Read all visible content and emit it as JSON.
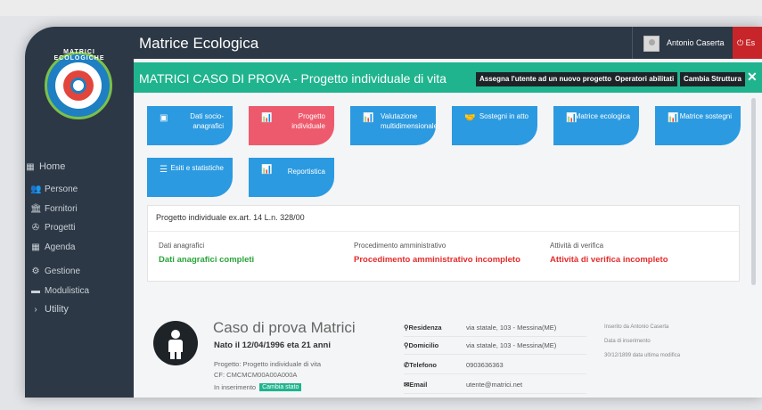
{
  "app": {
    "title": "Matrice Ecologica"
  },
  "logo": {
    "text": "MATRICI ECOLOGICHE"
  },
  "user": {
    "name": "Antonio Caserta",
    "exit_label": "Es"
  },
  "sidebar": {
    "items": [
      {
        "icon": "calendar-icon",
        "glyph": "▦",
        "label": "Home"
      },
      {
        "icon": "users-icon",
        "glyph": "👥",
        "label": "Persone"
      },
      {
        "icon": "bank-icon",
        "glyph": "🏛",
        "label": "Fornitori"
      },
      {
        "icon": "projects-icon",
        "glyph": "✇",
        "label": "Progetti"
      },
      {
        "icon": "calendar-icon",
        "glyph": "▦",
        "label": "Agenda"
      },
      {
        "icon": "gears-icon",
        "glyph": "⚙",
        "label": "Gestione"
      },
      {
        "icon": "folder-icon",
        "glyph": "▬",
        "label": "Modulistica"
      },
      {
        "icon": "chevron-right-icon",
        "glyph": "›",
        "label": "Utility"
      }
    ]
  },
  "banner": {
    "title": "MATRICI CASO DI PROVA - Progetto individuale di vita",
    "buttons": [
      "Assegna l'utente ad un nuovo progetto",
      "Operatori abilitati",
      "Cambia Struttura"
    ],
    "close": "✕"
  },
  "tiles": [
    {
      "label": "Dati socio-anagrafici",
      "icon": "id-card-icon",
      "glyph": "▣",
      "color": "#2b9ae0"
    },
    {
      "label": "Progetto individuale",
      "icon": "bar-chart-icon",
      "glyph": "📊",
      "color": "#ee5a6d"
    },
    {
      "label": "Valutazione multidimensionale",
      "icon": "bar-chart-icon",
      "glyph": "📊",
      "color": "#2b9ae0"
    },
    {
      "label": "Sostegni in atto",
      "icon": "handshake-icon",
      "glyph": "🤝",
      "color": "#2b9ae0"
    },
    {
      "label": "Matrice ecologica",
      "icon": "bar-chart-icon",
      "glyph": "📊",
      "color": "#2b9ae0"
    },
    {
      "label": "Matrice sostegni",
      "icon": "bar-chart-icon",
      "glyph": "📊",
      "color": "#2b9ae0"
    },
    {
      "label": "Esiti e statistiche",
      "icon": "list-icon",
      "glyph": "☰",
      "color": "#2b9ae0"
    },
    {
      "label": "Reportistica",
      "icon": "bar-chart-icon",
      "glyph": "📊",
      "color": "#2b9ae0"
    }
  ],
  "status_card": {
    "title": "Progetto individuale ex.art. 14 L.n. 328/00",
    "columns": [
      {
        "label": "Dati anagrafici",
        "value": "Dati anagrafici completi",
        "state": "ok"
      },
      {
        "label": "Procedimento amministrativo",
        "value": "Procedimento amministrativo incompleto",
        "state": "ko"
      },
      {
        "label": "Attività di verifica",
        "value": "Attività di verifica incompleto",
        "state": "ko"
      }
    ]
  },
  "person": {
    "name": "Caso di prova Matrici",
    "birth": "Nato il 12/04/1996 eta 21 anni",
    "project": "Progetto: Progetto individuale di vita",
    "cf": "CF: CMCMCM00A00A000A",
    "status": "In inserimento",
    "status_button": "Cambia stato",
    "contacts": [
      {
        "icon": "map-marker-icon",
        "glyph": "⚲",
        "key": "Residenza",
        "value": "via statale, 103 - Messina(ME)"
      },
      {
        "icon": "map-marker-icon",
        "glyph": "⚲",
        "key": "Domicilio",
        "value": "via statale, 103 - Messina(ME)"
      },
      {
        "icon": "phone-icon",
        "glyph": "✆",
        "key": "Telefono",
        "value": "0903636363"
      },
      {
        "icon": "envelope-icon",
        "glyph": "✉",
        "key": "Email",
        "value": "utente@matrici.net"
      }
    ],
    "meta": [
      "Inserito da Antonio Caserta",
      "Data di inserimento",
      "30/12/1899 data ultima modifica"
    ]
  }
}
